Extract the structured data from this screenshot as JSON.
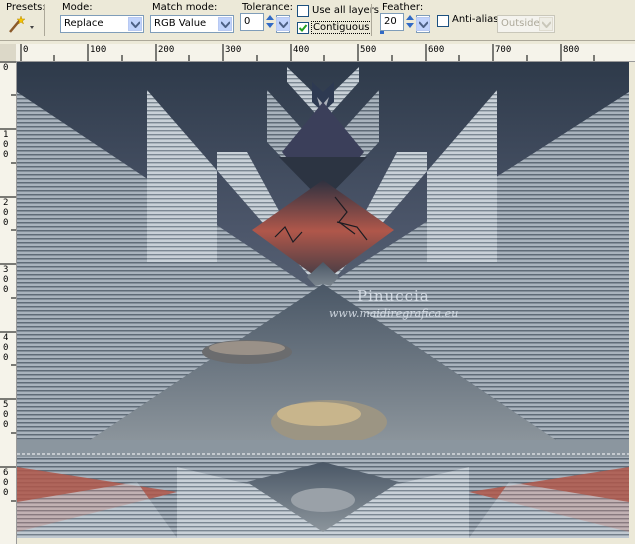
{
  "toolbar": {
    "presets_label": "Presets:",
    "mode_label": "Mode:",
    "mode_value": "Replace",
    "match_mode_label": "Match mode:",
    "match_mode_value": "RGB Value",
    "tolerance_label": "Tolerance:",
    "tolerance_value": "0",
    "use_all_layers_label": "Use all layers",
    "use_all_layers_checked": false,
    "contiguous_label": "Contiguous",
    "contiguous_checked": true,
    "feather_label": "Feather:",
    "feather_value": "20",
    "anti_alias_label": "Anti-alias",
    "anti_alias_checked": false,
    "inside_outside_value": "Outside"
  },
  "ruler": {
    "h_ticks": [
      "0",
      "100",
      "200",
      "300",
      "400",
      "500",
      "600",
      "700",
      "800"
    ],
    "v_ticks": [
      "0",
      "100",
      "200",
      "300",
      "400",
      "500",
      "600"
    ]
  },
  "canvas": {
    "watermark_title": "Pinuccia",
    "watermark_url": "www.maidiregrafica.eu"
  },
  "colors": {
    "accent": "#316ac5",
    "toolbar_bg": "#ece9d8",
    "sky": "#3e4a5a",
    "sunset": "#b0574a"
  }
}
